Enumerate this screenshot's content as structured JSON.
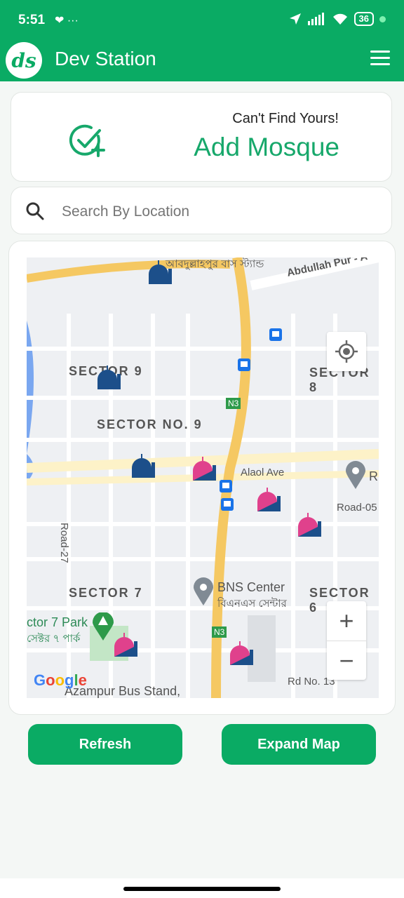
{
  "status": {
    "time": "5:51",
    "left_icons": "❤ ···",
    "battery": "36"
  },
  "app": {
    "title": "Dev Station",
    "logo_text": "ds"
  },
  "add_card": {
    "small_text": "Can't Find Yours!",
    "big_text": "Add Mosque"
  },
  "search": {
    "placeholder": "Search By Location"
  },
  "map": {
    "labels": {
      "sector9": "SECTOR 9",
      "sector_no9": "SECTOR NO. 9",
      "sector8": "SECTOR 8",
      "sector7": "SECTOR 7",
      "sector6": "SECTOR 6",
      "abdullahpur": "Abdullah Pur - A",
      "bus_stand_bn": "আবদুল্লাহপুর বাস স্ট্যান্ড",
      "alaol": "Alaol Ave",
      "road05": "Road-05",
      "road27": "Road-27",
      "bns": "BNS Center",
      "bns_bn": "বিএনএস সেন্টার",
      "park": "ctor 7 Park",
      "park_bn": "সেক্টর ৭ পার্ক",
      "n3_a": "N3",
      "n3_b": "N3",
      "rd13": "Rd No. 13",
      "azampur": "Azampur Bus Stand,",
      "r": "R"
    },
    "zoom_in": "+",
    "zoom_out": "−",
    "google": "Google"
  },
  "buttons": {
    "refresh": "Refresh",
    "expand": "Expand Map"
  },
  "colors": {
    "primary": "#0aab64",
    "mosque_blue": "#1c4f8a",
    "mosque_pink": "#e0418c"
  }
}
